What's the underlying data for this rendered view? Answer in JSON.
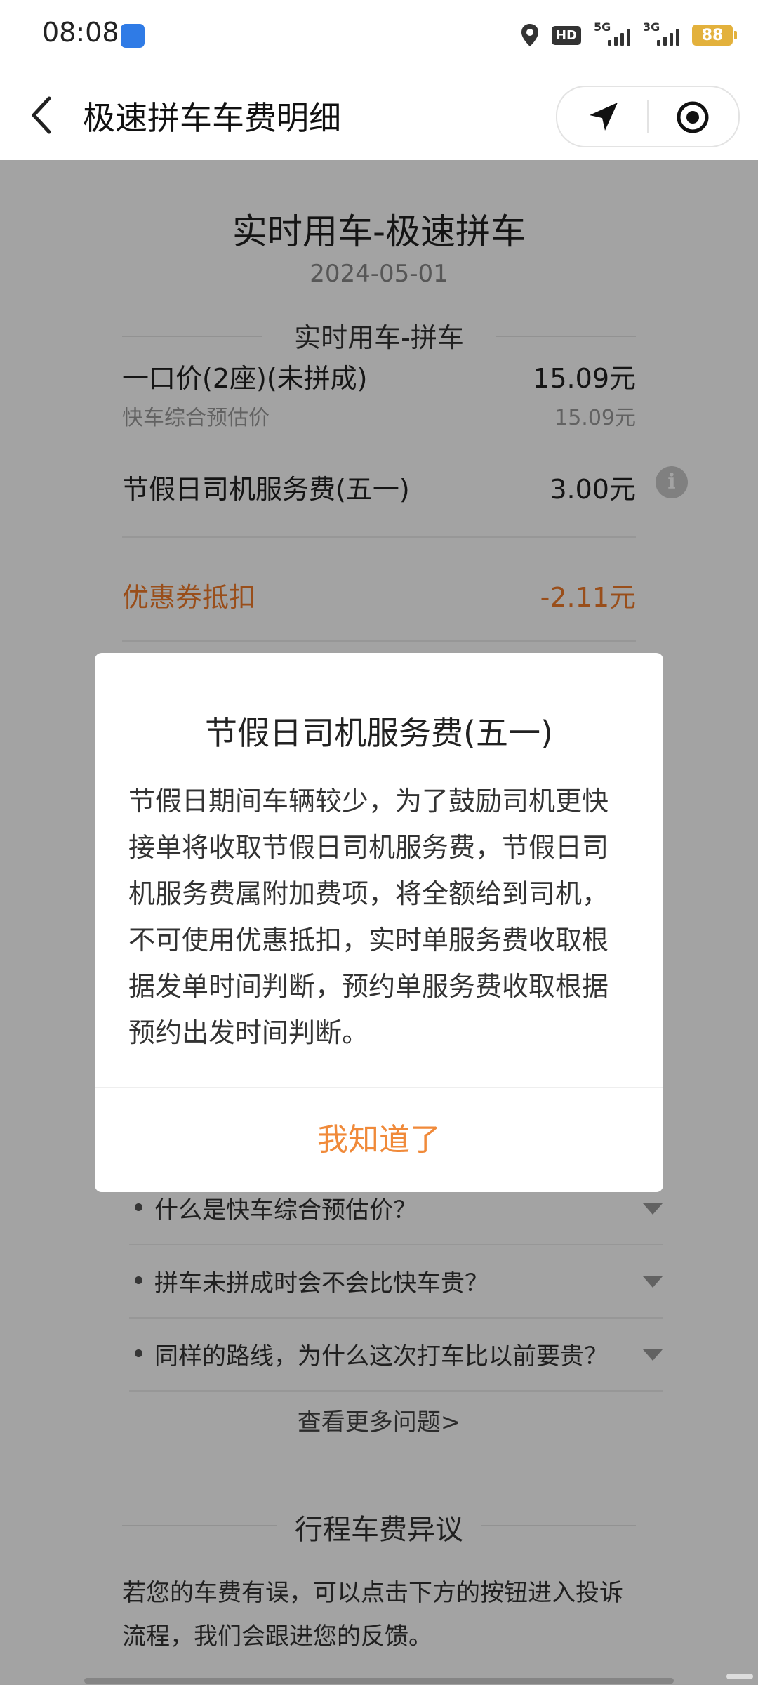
{
  "status_bar": {
    "time": "08:08",
    "hd_label": "HD",
    "sim1_label": "5G",
    "sim2_label": "3G",
    "battery": "88"
  },
  "nav": {
    "title": "极速拼车车费明细"
  },
  "fare": {
    "title": "实时用车-极速拼车",
    "date": "2024-05-01",
    "subtitle": "实时用车-拼车",
    "base_label": "一口价(2座)(未拼成)",
    "base_value": "15.09元",
    "estimate_label": "快车综合预估价",
    "estimate_value": "15.09元",
    "holiday_label": "节假日司机服务费(五一)",
    "holiday_value": "3.00元",
    "coupon_label": "优惠券抵扣",
    "coupon_value": "-2.11元"
  },
  "faq": {
    "items": [
      {
        "text": "什么是快车综合预估价？"
      },
      {
        "text": "拼车未拼成时会不会比快车贵？"
      },
      {
        "text": "同样的路线，为什么这次打车比以前要贵？"
      }
    ],
    "more_label": "查看更多问题>"
  },
  "dispute": {
    "title": "行程车费异议",
    "description": "若您的车费有误，可以点击下方的按钮进入投诉流程，我们会跟进您的反馈。"
  },
  "dialog": {
    "title": "节假日司机服务费(五一)",
    "body": "节假日期间车辆较少，为了鼓励司机更快接单将收取节假日司机服务费，节假日司机服务费属附加费项，将全额给到司机，不可使用优惠抵扣，实时单服务费收取根据发单时间判断，预约单服务费收取根据预约出发时间判断。",
    "confirm_label": "我知道了"
  },
  "colors": {
    "accent": "#f08a3a",
    "coupon": "#f07a2a",
    "battery": "#e3b13c"
  }
}
